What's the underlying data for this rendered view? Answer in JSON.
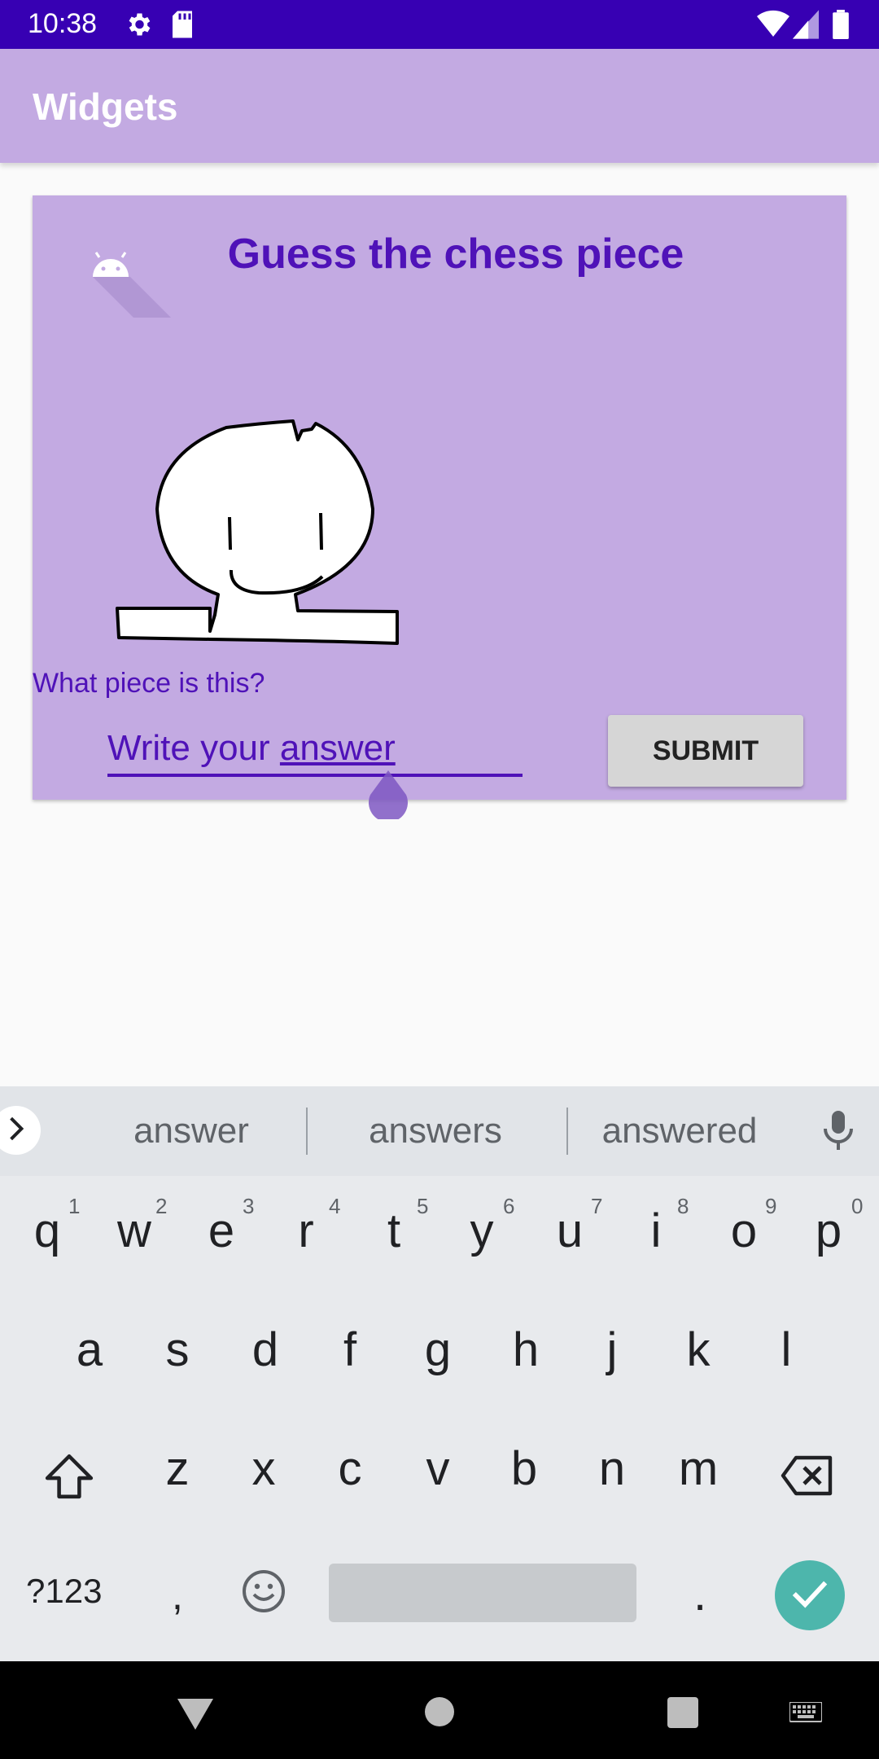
{
  "status": {
    "time": "10:38",
    "icons": [
      "gear-icon",
      "sd-card-icon",
      "wifi-icon",
      "signal-icon",
      "battery-icon"
    ]
  },
  "appbar": {
    "title": "Widgets"
  },
  "card": {
    "title": "Guess the chess piece",
    "question": "What piece is this?",
    "answer_prefix": "Write your ",
    "answer_word": "answer",
    "submit_label": "SUBMIT"
  },
  "keyboard": {
    "suggestions": [
      "answer",
      "answers",
      "answered"
    ],
    "row1": [
      "q",
      "w",
      "e",
      "r",
      "t",
      "y",
      "u",
      "i",
      "o",
      "p"
    ],
    "row1_hints": [
      "1",
      "2",
      "3",
      "4",
      "5",
      "6",
      "7",
      "8",
      "9",
      "0"
    ],
    "row2": [
      "a",
      "s",
      "d",
      "f",
      "g",
      "h",
      "j",
      "k",
      "l"
    ],
    "row3": [
      "z",
      "x",
      "c",
      "v",
      "b",
      "n",
      "m"
    ],
    "symbols_label": "?123",
    "comma": ",",
    "period": "."
  },
  "colors": {
    "status_bar": "#3700b3",
    "app_bar": "#c3aae2",
    "accent": "#4f12b8",
    "enter_key": "#4db6ac"
  }
}
